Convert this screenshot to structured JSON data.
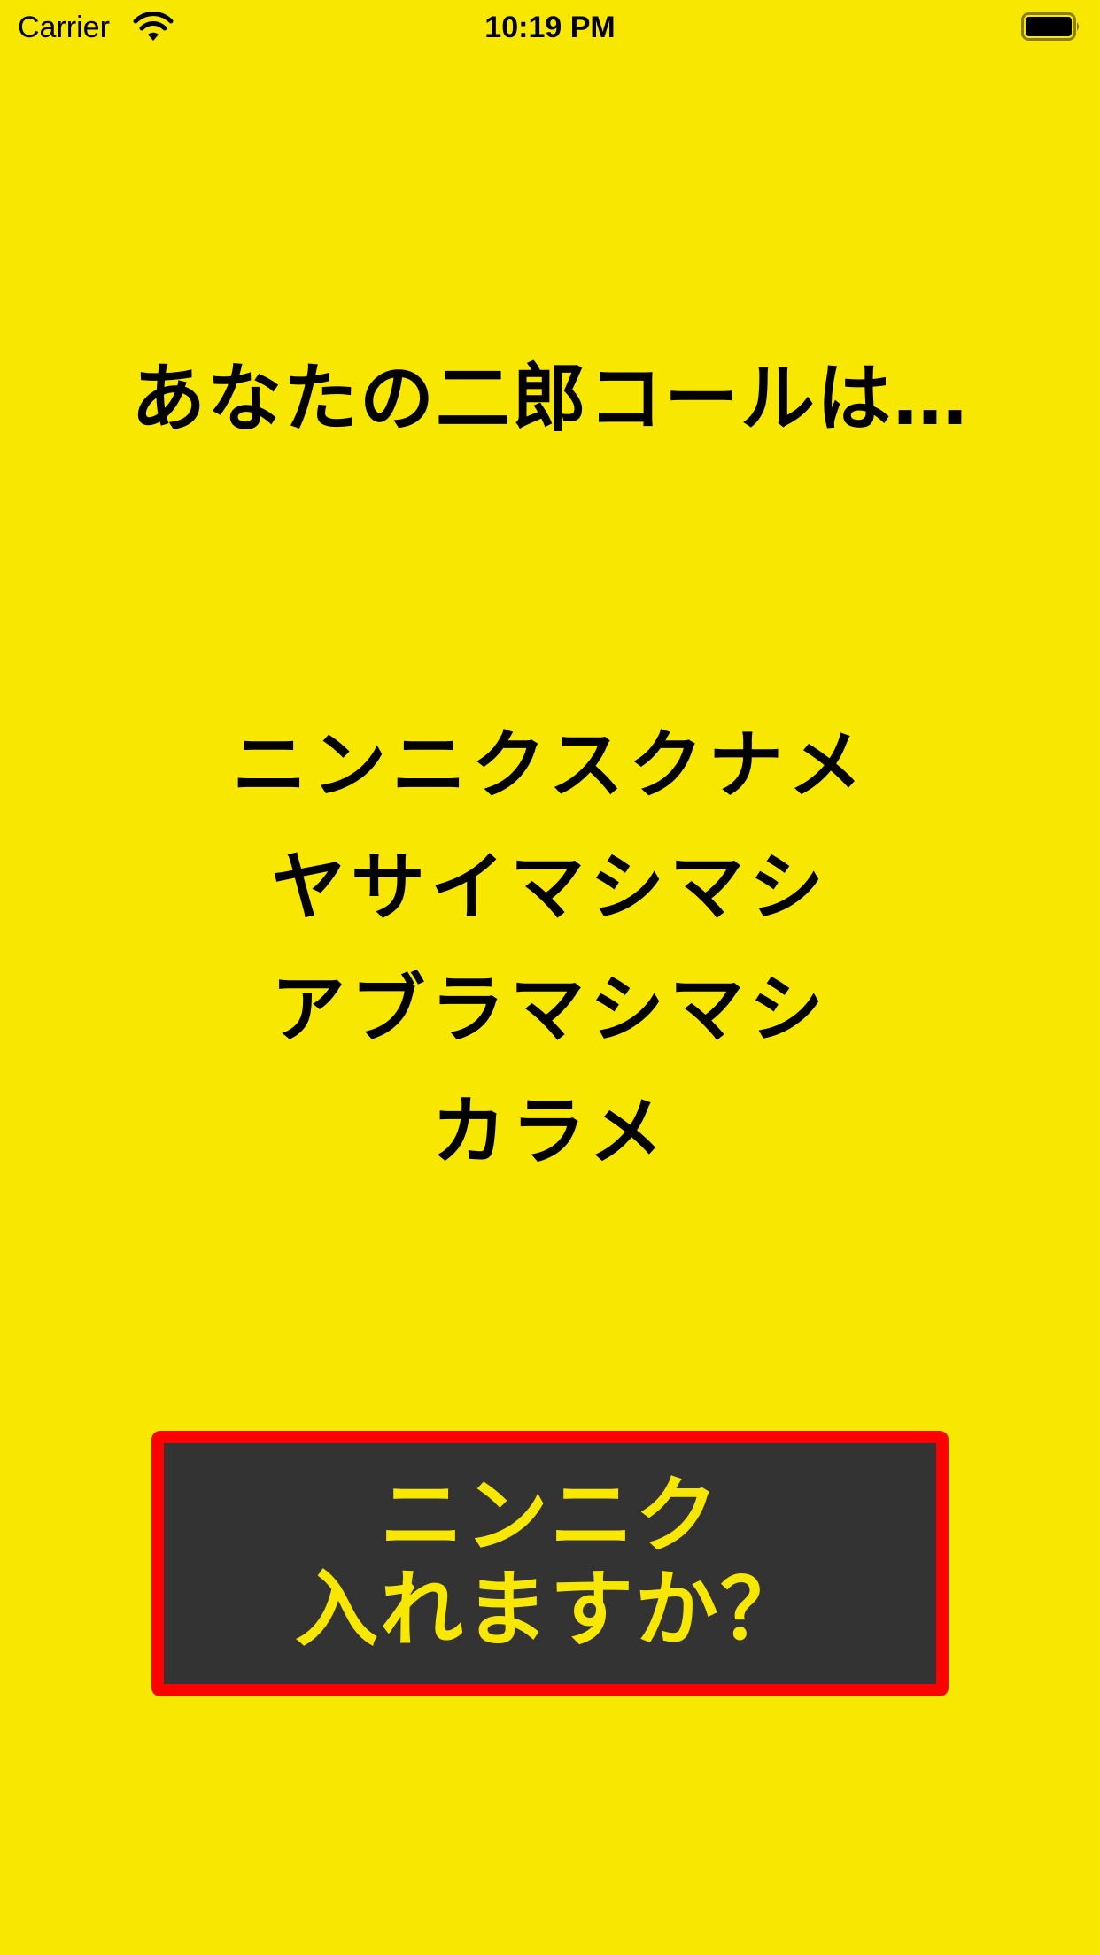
{
  "status_bar": {
    "carrier": "Carrier",
    "time": "10:19 PM"
  },
  "title": "あなたの二郎コールは…",
  "result": {
    "lines": [
      "ニンニクスクナメ",
      "ヤサイマシマシ",
      "アブラマシマシ",
      "カラメ"
    ]
  },
  "button": {
    "line1": "ニンニク",
    "line2": "入れますか？"
  },
  "colors": {
    "background": "#F8E700",
    "button_background": "#333333",
    "button_border": "#FF0000",
    "button_text": "#F8E700"
  }
}
